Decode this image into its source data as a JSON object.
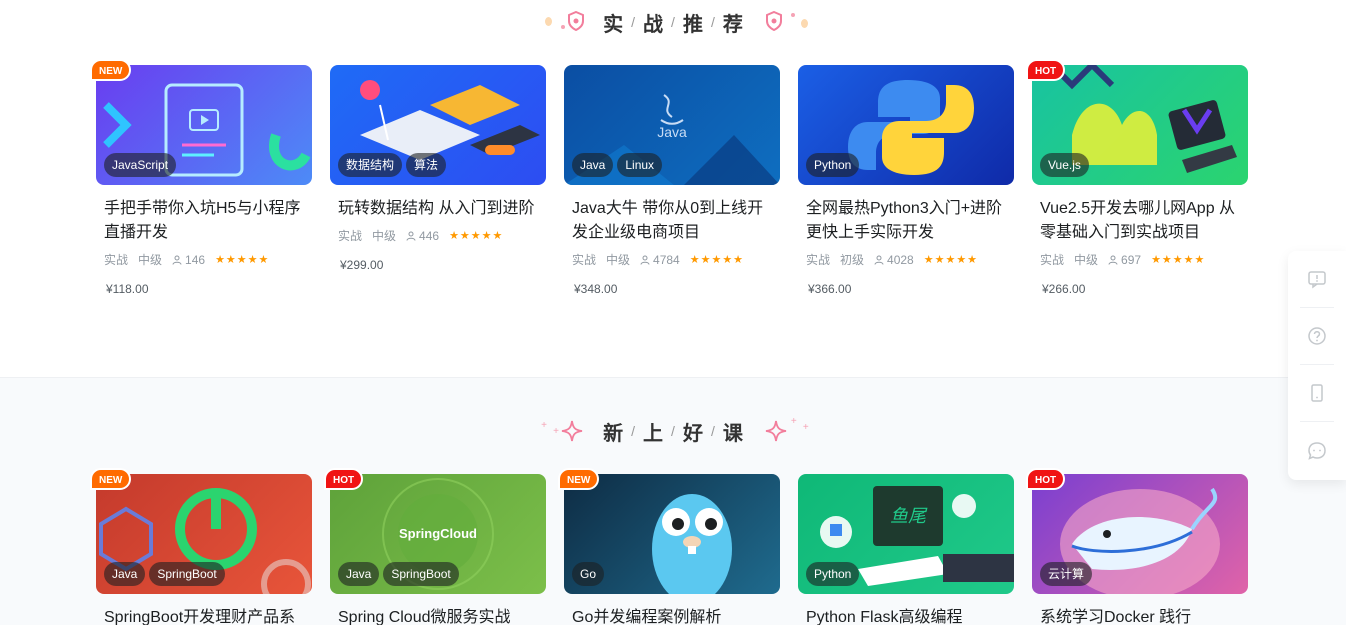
{
  "section1": {
    "chars": [
      "实",
      "战",
      "推",
      "荐"
    ],
    "separator": "/",
    "cards": [
      {
        "badge": "NEW",
        "tags": [
          "JavaScript"
        ],
        "title": "手把手带你入坑H5与小程序直播开发",
        "type": "实战",
        "level": "中级",
        "students": "146",
        "price": "¥118.00",
        "colors": [
          "#6a3df0",
          "#4d8bf7"
        ]
      },
      {
        "badge": "",
        "tags": [
          "数据结构",
          "算法"
        ],
        "title": "玩转数据结构 从入门到进阶",
        "type": "实战",
        "level": "中级",
        "students": "446",
        "price": "¥299.00",
        "colors": [
          "#1f6bf6",
          "#2d4df2"
        ]
      },
      {
        "badge": "",
        "tags": [
          "Java",
          "Linux"
        ],
        "title": "Java大牛 带你从0到上线开发企业级电商项目",
        "type": "实战",
        "level": "中级",
        "students": "4784",
        "price": "¥348.00",
        "colors": [
          "#0b4ea3",
          "#0e6ec0"
        ]
      },
      {
        "badge": "",
        "tags": [
          "Python"
        ],
        "title": "全网最热Python3入门+进阶 更快上手实际开发",
        "type": "实战",
        "level": "初级",
        "students": "4028",
        "price": "¥366.00",
        "colors": [
          "#1b5fe6",
          "#0f2aa8"
        ]
      },
      {
        "badge": "HOT",
        "tags": [
          "Vue.js"
        ],
        "title": "Vue2.5开发去哪儿网App 从零基础入门到实战项目",
        "type": "实战",
        "level": "中级",
        "students": "697",
        "price": "¥266.00",
        "colors": [
          "#18c3a1",
          "#2bd46f"
        ]
      }
    ]
  },
  "section2": {
    "chars": [
      "新",
      "上",
      "好",
      "课"
    ],
    "separator": "/",
    "cards": [
      {
        "badge": "NEW",
        "tags": [
          "Java",
          "SpringBoot"
        ],
        "title": "SpringBoot开发理财产品系",
        "colors": [
          "#c43a2c",
          "#e8553a"
        ]
      },
      {
        "badge": "HOT",
        "tags": [
          "Java",
          "SpringBoot"
        ],
        "title": "Spring Cloud微服务实战",
        "colors": [
          "#5ea23a",
          "#7cbf4a"
        ],
        "center_text": "SpringCloud"
      },
      {
        "badge": "NEW",
        "tags": [
          "Go"
        ],
        "title": "Go并发编程案例解析",
        "colors": [
          "#0e2c44",
          "#1f6b8e"
        ]
      },
      {
        "badge": "",
        "tags": [
          "Python"
        ],
        "title": "Python Flask高级编程",
        "colors": [
          "#0fb877",
          "#20c98a"
        ]
      },
      {
        "badge": "HOT",
        "tags": [
          "云计算"
        ],
        "title": "系统学习Docker 践行",
        "colors": [
          "#7a3fd1",
          "#e063a8"
        ]
      }
    ]
  },
  "icons": {
    "java_logo_text": "Java",
    "tv_icon": "tv-icon",
    "python_logo": "python-logo-icon"
  },
  "side_panel": [
    "feedback-icon",
    "help-icon",
    "mobile-icon",
    "chat-icon"
  ]
}
